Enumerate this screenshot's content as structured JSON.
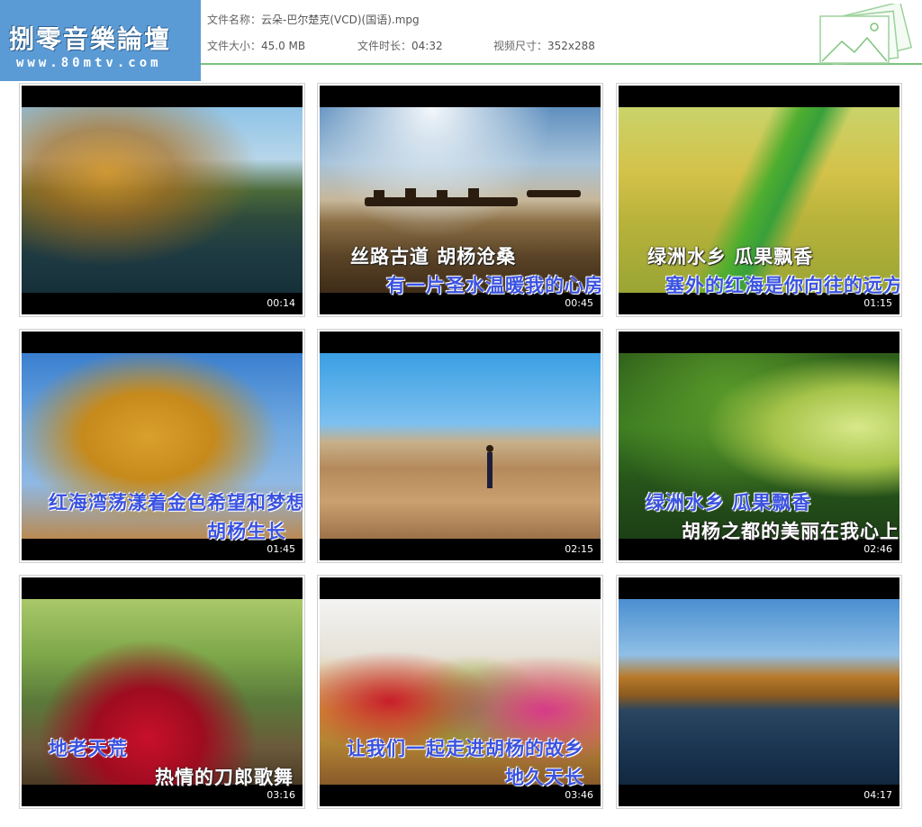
{
  "header": {
    "logo_title": "捌零音樂論壇",
    "logo_url": "www.80mtv.com",
    "file_name_label": "文件名称：",
    "file_name": "云朵-巴尔楚克(VCD)(国语).mpg",
    "file_size_label": "文件大小：",
    "file_size": "45.0 MB",
    "duration_label": "文件时长：",
    "duration": "04:32",
    "resolution_label": "视频尺寸：",
    "resolution": "352x288"
  },
  "thumbnails": [
    {
      "time": "00:14",
      "lyric1": "",
      "lyric2": ""
    },
    {
      "time": "00:45",
      "lyric1": "丝路古道  胡杨沧桑",
      "lyric2": "有一片圣水温暖我的心房"
    },
    {
      "time": "01:15",
      "lyric1": "绿洲水乡  瓜果飘香",
      "lyric2": "塞外的红海是你向往的远方"
    },
    {
      "time": "01:45",
      "lyric1": "红海湾荡漾着金色希望和梦想",
      "lyric2": "胡杨生长"
    },
    {
      "time": "02:15",
      "lyric1": "",
      "lyric2": ""
    },
    {
      "time": "02:46",
      "lyric1": "绿洲水乡  瓜果飘香",
      "lyric2": "胡杨之都的美丽在我心上"
    },
    {
      "time": "03:16",
      "lyric1": "地老天荒",
      "lyric2": "热情的刀郎歌舞"
    },
    {
      "time": "03:46",
      "lyric1": "让我们一起走进胡杨的故乡",
      "lyric2": "地久天长"
    },
    {
      "time": "04:17",
      "lyric1": "",
      "lyric2": ""
    }
  ],
  "colors": {
    "header_logo_bg": "#5b9bd5",
    "header_line": "#7cc47c",
    "lyric_highlight": "#3a52e0"
  }
}
